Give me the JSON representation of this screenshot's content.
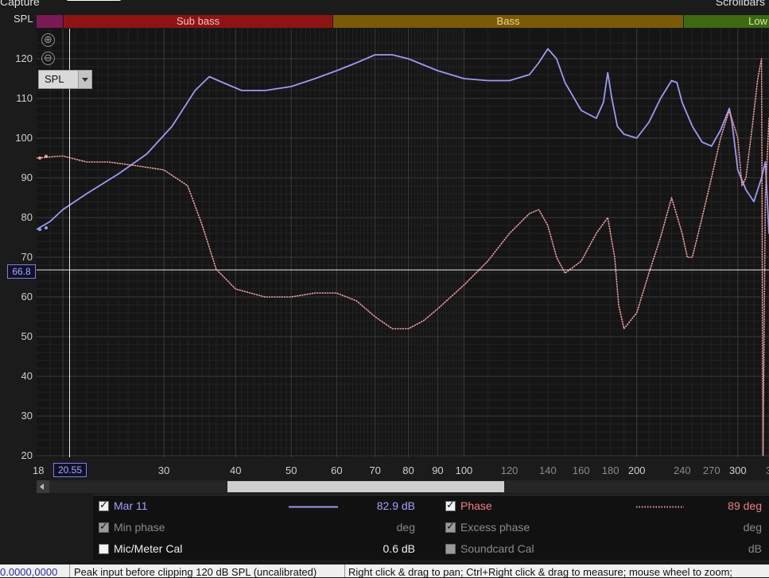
{
  "header": {
    "capture_label": "Capture",
    "scrollbars_label": "Scrollbars",
    "y_axis_label": "SPL"
  },
  "bands": [
    {
      "label": "",
      "color": "#7a1a55",
      "text_color": "#ffffff"
    },
    {
      "label": "Sub bass",
      "color": "#8e1414",
      "text_color": "#f0c0c0"
    },
    {
      "label": "Bass",
      "color": "#7a5a06",
      "text_color": "#f0d890"
    },
    {
      "label": "Low",
      "color": "#3d6a10",
      "text_color": "#d0ecb0"
    }
  ],
  "controls": {
    "zoom_in": "⊕",
    "zoom_out": "⊖",
    "dropdown_value": "SPL"
  },
  "cursor": {
    "y_value": "66.8",
    "x_value": "20.55"
  },
  "legend": {
    "row1": {
      "name": "Mar 11",
      "value": "82.9 dB",
      "name2": "Phase",
      "value2": "89 deg"
    },
    "row2": {
      "name": "Min phase",
      "value": "deg",
      "name2": "Excess phase",
      "value2": "deg"
    },
    "row3": {
      "name": "Mic/Meter Cal",
      "value": "0.6 dB",
      "name2": "Soundcard Cal",
      "value2": "dB"
    }
  },
  "status": {
    "left": "0.0000,0000",
    "middle": "Peak input before clipping 120 dB SPL (uncalibrated)",
    "right": "Right click & drag to pan; Ctrl+Right click & drag to measure; mouse wheel to zoom;"
  },
  "chart_data": {
    "type": "line",
    "x_scale": "log",
    "xlim": [
      18,
      340
    ],
    "ylim": [
      20,
      120
    ],
    "x_ticks": [
      "18",
      "30",
      "40",
      "50",
      "60",
      "70",
      "80",
      "90",
      "100",
      "120",
      "140",
      "160",
      "180",
      "200",
      "240",
      "270",
      "300",
      "3"
    ],
    "y_ticks": [
      "120",
      "110",
      "100",
      "90",
      "80",
      "70",
      "60",
      "50",
      "40",
      "30",
      "20"
    ],
    "grid": true,
    "series": [
      {
        "name": "Mar 11",
        "color": "#9a9af5",
        "style": "solid",
        "x": [
          18,
          19,
          20,
          22,
          25,
          28,
          31,
          34,
          36,
          38,
          41,
          45,
          50,
          55,
          60,
          65,
          70,
          75,
          80,
          90,
          100,
          110,
          120,
          130,
          135,
          140,
          145,
          150,
          160,
          170,
          175,
          178,
          181,
          185,
          190,
          200,
          210,
          220,
          230,
          235,
          240,
          250,
          260,
          270,
          280,
          290,
          293,
          300,
          310,
          320,
          330,
          335,
          340
        ],
        "y": [
          77,
          79,
          82,
          86,
          91,
          96,
          103,
          112,
          115.5,
          114,
          112,
          112,
          113,
          115,
          117,
          119,
          121,
          121,
          120,
          117,
          115,
          114.5,
          114.5,
          116,
          119,
          122.5,
          120,
          114,
          107,
          105,
          109,
          116.5,
          110,
          103,
          101,
          100,
          104,
          110,
          114.5,
          114,
          109,
          103,
          99,
          98,
          102,
          107.5,
          104,
          92,
          87,
          84,
          90,
          94,
          76
        ]
      },
      {
        "name": "Phase",
        "color": "#f0a0a0",
        "style": "dotted",
        "x": [
          18,
          20,
          22,
          24,
          27,
          30,
          33,
          35,
          37,
          40,
          45,
          50,
          55,
          60,
          65,
          70,
          75,
          80,
          85,
          90,
          100,
          110,
          120,
          130,
          135,
          140,
          145,
          150,
          160,
          170,
          178,
          183,
          186,
          190,
          200,
          210,
          220,
          230,
          240,
          245,
          250,
          260,
          270,
          280,
          290,
          300,
          305,
          310,
          318,
          325,
          330,
          332,
          335,
          340
        ],
        "y": [
          95,
          95.5,
          94,
          94,
          93,
          92,
          88,
          78,
          67,
          62,
          60,
          60,
          61,
          61,
          59,
          55,
          52,
          52,
          54,
          57,
          63,
          69,
          76,
          81,
          82,
          78,
          70,
          66,
          69,
          76,
          80,
          70,
          58,
          52,
          56,
          66,
          75,
          85,
          76,
          70,
          70,
          80,
          90,
          100,
          107,
          100,
          88,
          90,
          103,
          115,
          120,
          20,
          85,
          105
        ]
      }
    ]
  }
}
